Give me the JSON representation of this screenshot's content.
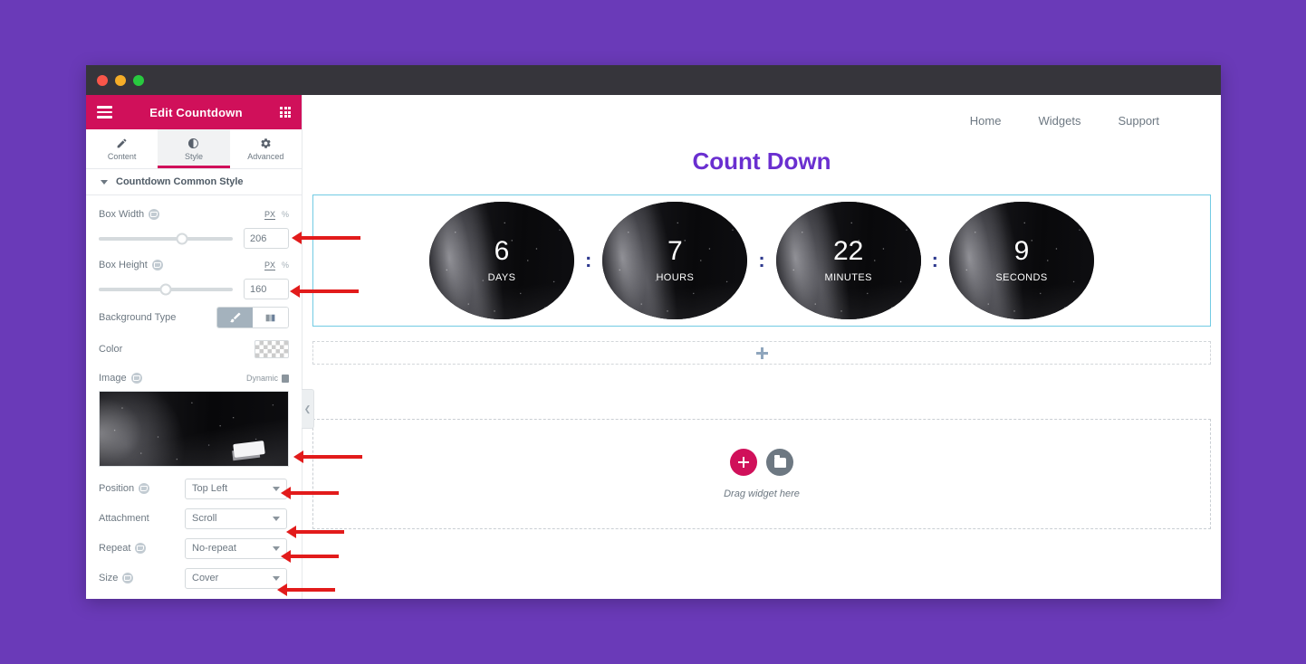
{
  "theme": {
    "desktop_bg": "#6a3ab8",
    "titlebar_bg": "#36353b",
    "panel_accent": "#d0105a",
    "canvas_title_color": "#6a2fd0",
    "section_border": "#72cbe3",
    "arrow_color": "#e21b1b"
  },
  "window": {
    "controls": [
      "close",
      "minimize",
      "maximize"
    ]
  },
  "panel": {
    "title": "Edit Countdown",
    "menu_icon": "hamburger-icon",
    "grid_icon": "grid-icon",
    "tabs": [
      {
        "label": "Content",
        "icon": "pencil-icon",
        "active": false
      },
      {
        "label": "Style",
        "icon": "contrast-icon",
        "active": true
      },
      {
        "label": "Advanced",
        "icon": "gear-icon",
        "active": false
      }
    ],
    "section": {
      "label": "Countdown Common Style",
      "expanded": true
    },
    "controls": {
      "box_width": {
        "label": "Box Width",
        "value": "206",
        "units": [
          "PX",
          "%"
        ],
        "active_unit": "PX",
        "slider_percent": 62
      },
      "box_height": {
        "label": "Box Height",
        "value": "160",
        "units": [
          "PX",
          "%"
        ],
        "active_unit": "PX",
        "slider_percent": 50
      },
      "background_type": {
        "label": "Background Type",
        "options": [
          "classic",
          "gradient"
        ],
        "active": "classic"
      },
      "color": {
        "label": "Color",
        "value": "transparent"
      },
      "image": {
        "label": "Image",
        "dynamic_label": "Dynamic"
      },
      "position": {
        "label": "Position",
        "value": "Top Left"
      },
      "attachment": {
        "label": "Attachment",
        "value": "Scroll"
      },
      "repeat": {
        "label": "Repeat",
        "value": "No-repeat"
      },
      "size": {
        "label": "Size",
        "value": "Cover"
      }
    },
    "collapse_icon": "chevron-left-icon"
  },
  "canvas": {
    "nav": [
      {
        "label": "Home"
      },
      {
        "label": "Widgets"
      },
      {
        "label": "Support"
      }
    ],
    "countdown_title": "Count Down",
    "countdown_items": [
      {
        "value": "6",
        "label": "DAYS"
      },
      {
        "value": "7",
        "label": "HOURS"
      },
      {
        "value": "22",
        "label": "MINUTES"
      },
      {
        "value": "9",
        "label": "SECONDS"
      }
    ],
    "separator": ":",
    "add_section_icon": "plus-icon",
    "drop_zone": {
      "add_icon": "plus-icon",
      "folder_icon": "folder-icon",
      "label": "Drag widget here"
    }
  },
  "annotations": {
    "arrows": [
      {
        "target": "box-width-input"
      },
      {
        "target": "box-height-input"
      },
      {
        "target": "image-thumbnail"
      },
      {
        "target": "position-select"
      },
      {
        "target": "attachment-select"
      },
      {
        "target": "repeat-select"
      },
      {
        "target": "size-select"
      }
    ]
  }
}
